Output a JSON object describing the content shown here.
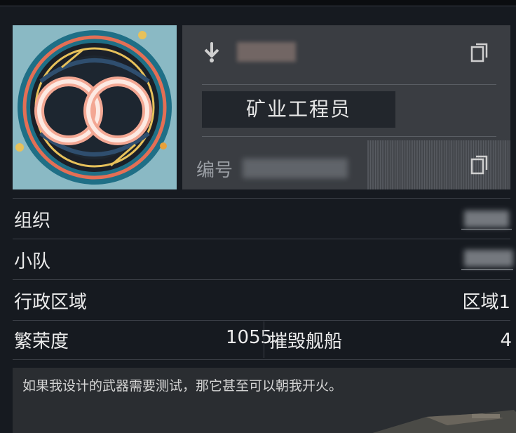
{
  "profile": {
    "title": "矿业工程员",
    "id_label": "编号"
  },
  "details": {
    "organization_label": "组织",
    "squad_label": "小队",
    "region_label": "行政区域",
    "region_value": "区域1",
    "prosperity_label": "繁荣度",
    "prosperity_value": "1055",
    "destroyed_ships_label": "摧毁舰船",
    "destroyed_ships_value": "4"
  },
  "bio": "如果我设计的武器需要测试，那它甚至可以朝我开火。",
  "icons": {
    "download": "download-icon",
    "copy": "copy-icon",
    "avatar": "interlocking-rings-emblem"
  },
  "colors": {
    "background": "#161a20",
    "panel": "#3a3d42",
    "role_badge": "#22262c",
    "avatar_bg": "#8ab9c4",
    "ring": "#f0a893"
  }
}
